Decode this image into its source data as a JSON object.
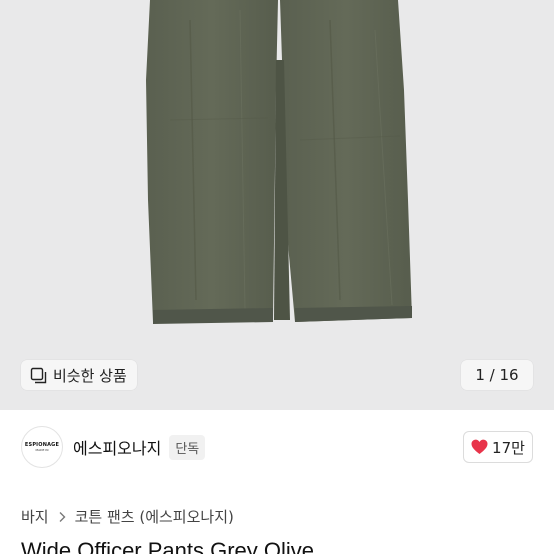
{
  "gallery": {
    "similar_label": "비슷한 상품",
    "similar_icon": "stacked-squares-icon",
    "pager": "1 / 16",
    "pants_color": "#5d6352"
  },
  "seller": {
    "avatar_logo_main": "ESPIONAGE",
    "avatar_logo_sub": "MADE IN",
    "name": "에스피오나지",
    "badge": "단독",
    "like_icon": "heart-icon",
    "like_color": "#e8344a",
    "like_count": "17만"
  },
  "breadcrumb": {
    "items": [
      "바지",
      "코튼 팬츠 (에스피오나지)"
    ],
    "separator_icon": "chevron-right-icon"
  },
  "product": {
    "title": "Wide Officer Pants Grey Olive"
  }
}
